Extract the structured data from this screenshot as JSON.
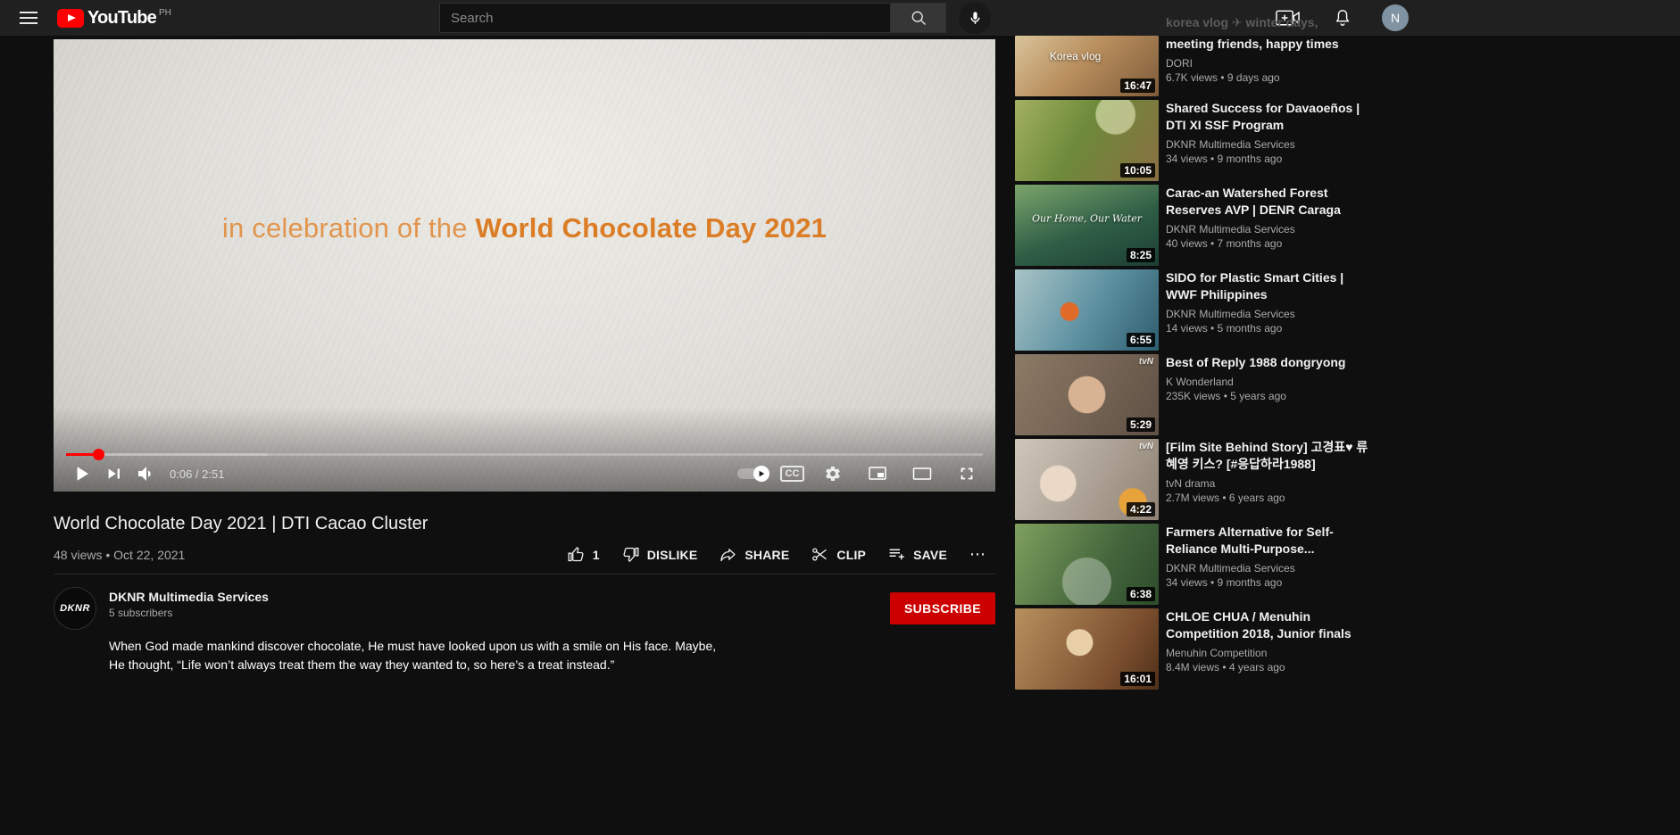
{
  "colors": {
    "youtube_red": "#ff0000",
    "subscribe_red": "#cc0000",
    "progress_red": "#ff0000",
    "caption_regular_orange": "#e1954e",
    "caption_bold_orange": "#db7d26",
    "masthead_bg": "#202020",
    "page_bg": "#0f0f0f"
  },
  "header": {
    "logo_text": "YouTube",
    "country_code": "PH",
    "search_placeholder": "Search",
    "avatar_initial": "N"
  },
  "player": {
    "caption_regular": "in celebration of the ",
    "caption_bold": "World Chocolate Day 2021",
    "time_display": "0:06 / 2:51",
    "current_time": "0:06",
    "duration": "2:51",
    "progress_percent": 3.5,
    "cc_label": "CC"
  },
  "video": {
    "title": "World Chocolate Day 2021 | DTI Cacao Cluster",
    "meta": "48 views • Oct 22, 2021",
    "actions": {
      "like_count": "1",
      "dislike": "DISLIKE",
      "share": "SHARE",
      "clip": "CLIP",
      "save": "SAVE",
      "more": "⋯"
    }
  },
  "channel": {
    "name": "DKNR Multimedia Services",
    "subscribers": "5 subscribers",
    "subscribe_label": "SUBSCRIBE",
    "avatar_text": "DKNR"
  },
  "description": {
    "text": "When God made mankind discover chocolate, He must have looked upon us with a smile on His face. Maybe, He thought, “Life won’t always treat them the way they wanted to, so here’s a treat instead.”"
  },
  "sidebar": {
    "clipped_title_line": "korea vlog ✈ winter days,",
    "videos": [
      {
        "title": "meeting friends, happy times",
        "channel": "DORI",
        "meta": "6.7K views • 9 days ago",
        "duration": "16:47",
        "clipped": true,
        "thumb": "linear-gradient(135deg,#d9c49a 0%,#b98f5e 45%,#7e5b39 100%)",
        "thumb_text": "Korea vlog"
      },
      {
        "title": "Shared Success for Davaoeños | DTI XI SSF Program",
        "channel": "DKNR Multimedia Services",
        "meta": "34 views • 9 months ago",
        "duration": "10:05",
        "thumb": "radial-gradient(circle at 70% 18%, rgba(255,255,215,0.5) 0 16%, transparent 17%), linear-gradient(120deg,#a3b063 0%,#6d8a3a 45%,#8a6f42 100%)"
      },
      {
        "title": "Carac-an Watershed Forest Reserves AVP | DENR Caraga",
        "channel": "DKNR Multimedia Services",
        "meta": "40 views • 7 months ago",
        "duration": "8:25",
        "thumb": "linear-gradient(160deg,#7ba56b 0%,#2f5e46 55%,#1d3f33 100%)",
        "thumb_text": "Our Home, Our Water",
        "thumb_text_style": "script"
      },
      {
        "title": "SIDO for Plastic Smart Cities | WWF Philippines",
        "channel": "DKNR Multimedia Services",
        "meta": "14 views • 5 months ago",
        "duration": "6:55",
        "thumb": "radial-gradient(circle at 38% 52%, #e06a28 0 9%, transparent 10%), linear-gradient(120deg,#a8c4c6 0%,#5b8fa0 55%,#2e5d6e 100%)"
      },
      {
        "title": "Best of Reply 1988 dongryong",
        "channel": "K Wonderland",
        "meta": "235K views • 5 years ago",
        "duration": "5:29",
        "thumb": "radial-gradient(circle at 50% 50%, #d7b293 0 22%, transparent 23%), linear-gradient(120deg,#8d7a66 0%,#5f5044 100%)",
        "corner_label": "tvN"
      },
      {
        "title": "[Film Site Behind Story] 고경표♥ 류혜영 키스? [#응답하라1988]",
        "channel": "tvN drama",
        "meta": "2.7M views • 6 years ago",
        "duration": "4:22",
        "thumb": "radial-gradient(circle at 82% 78%, #e8a23c 0 10%, transparent 11%), radial-gradient(circle at 30% 55%, #e9d9c6 0 16%, transparent 17%), linear-gradient(120deg,#cfc6bb 0%,#8f8274 100%)",
        "corner_label": "tvN"
      },
      {
        "title": "Farmers Alternative for Self-Reliance Multi-Purpose...",
        "channel": "DKNR Multimedia Services",
        "meta": "34 views • 9 months ago",
        "duration": "6:38",
        "thumb": "radial-gradient(circle at 50% 72%, rgba(240,240,240,0.35) 0 26%, transparent 27%), linear-gradient(120deg,#7fa05e 0%,#44663c 60%,#2e4a2c 100%)"
      },
      {
        "title": "CHLOE CHUA / Menuhin Competition 2018, Junior finals",
        "channel": "Menuhin Competition",
        "meta": "8.4M views • 4 years ago",
        "duration": "16:01",
        "thumb": "radial-gradient(circle at 45% 42%, #e8cfa8 0 14%, transparent 15%), linear-gradient(120deg,#b8905e 0%,#7a4e2e 70%,#4f3018 100%)"
      }
    ]
  }
}
